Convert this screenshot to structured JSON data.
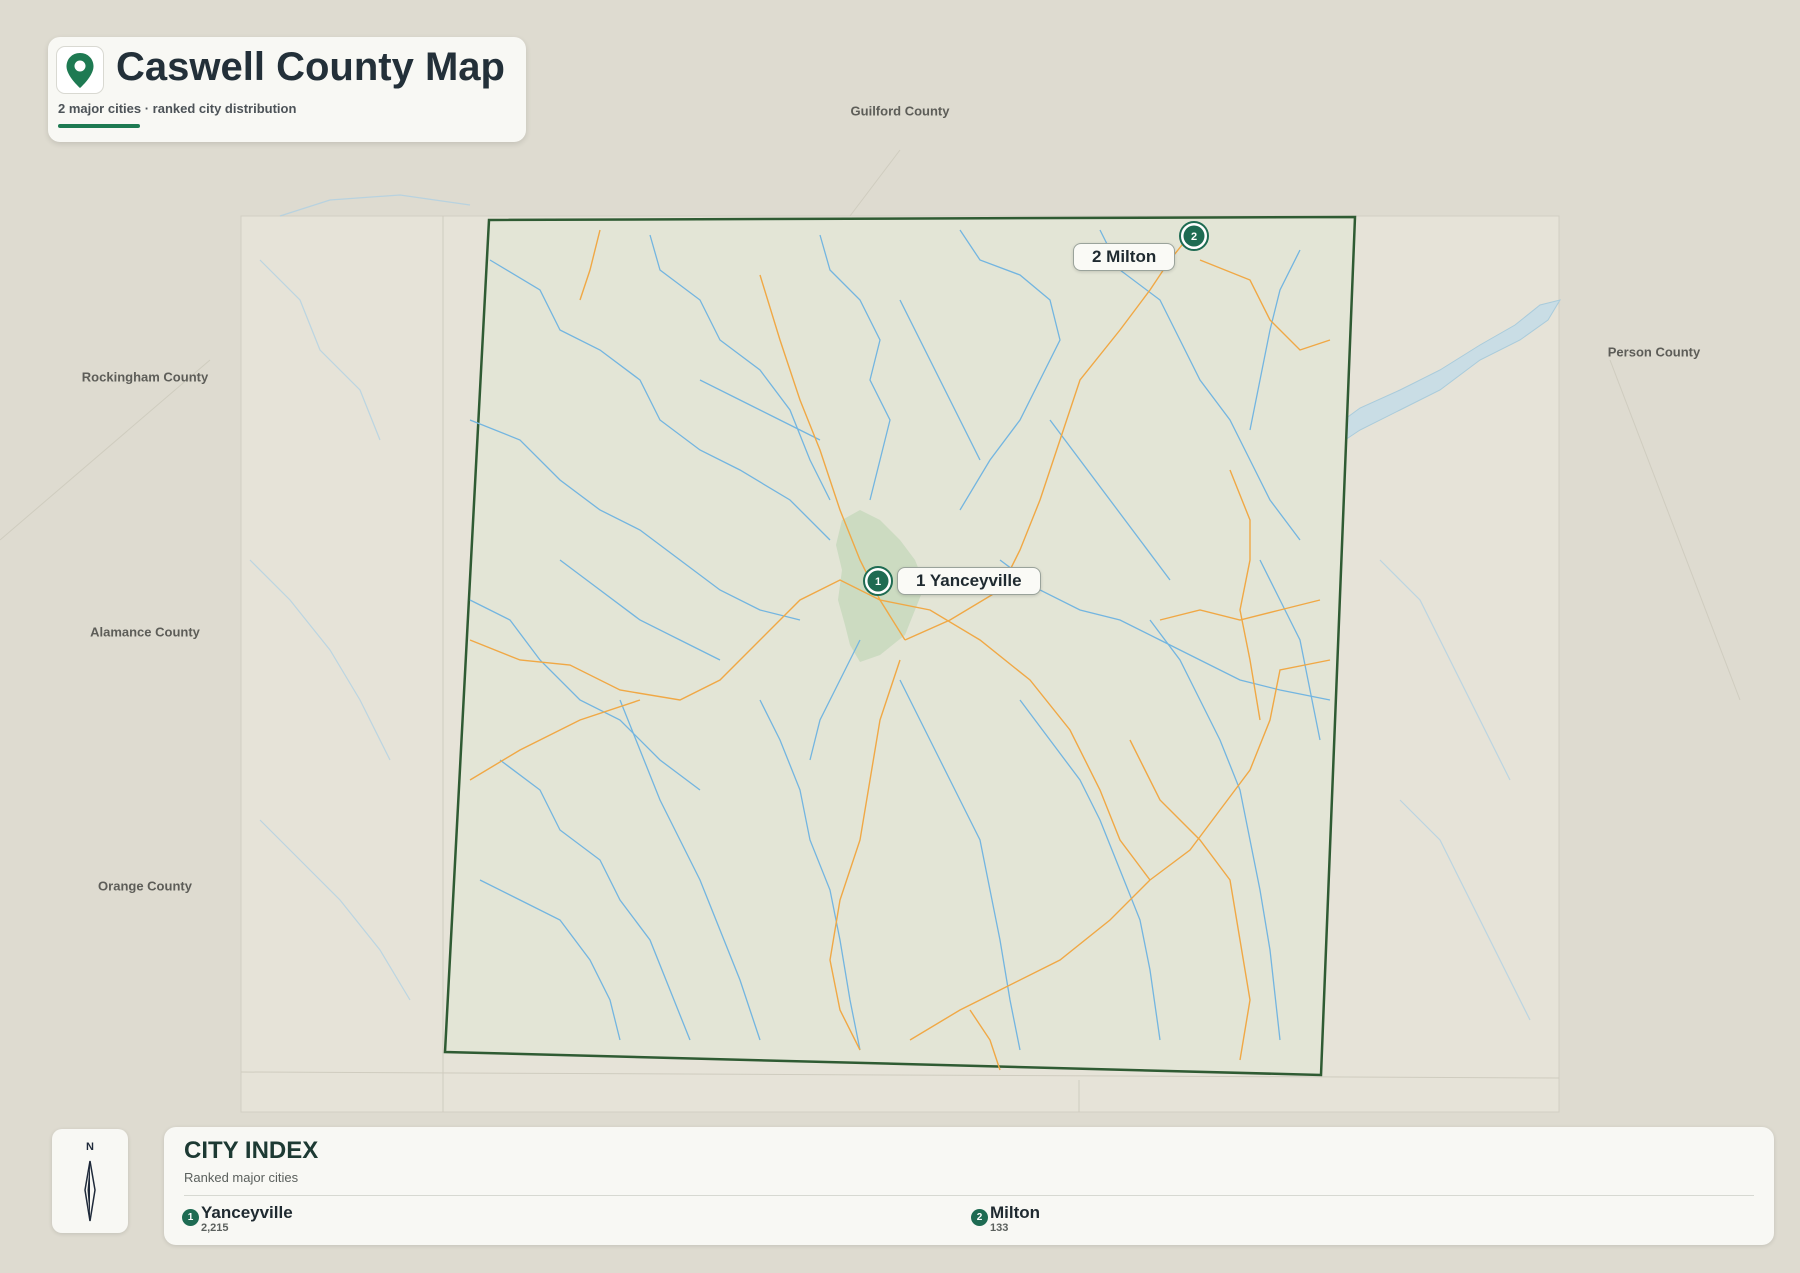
{
  "header": {
    "title": "Caswell County Map",
    "subtitle": "2 major cities · ranked city distribution"
  },
  "map": {
    "neighbors": [
      {
        "name": "Guilford County"
      },
      {
        "name": "Rockingham County"
      },
      {
        "name": "Person County"
      },
      {
        "name": "Alamance County"
      },
      {
        "name": "Orange County"
      }
    ],
    "cities": [
      {
        "rank": "1",
        "name": "Yanceyville",
        "label": "1 Yanceyville"
      },
      {
        "rank": "2",
        "name": "Milton",
        "label": "2 Milton"
      }
    ],
    "compass": {
      "north_label": "N"
    }
  },
  "index": {
    "title": "CITY INDEX",
    "subtitle": "Ranked major cities",
    "entries": [
      {
        "rank": "1",
        "name": "Yanceyville",
        "population": "2,215"
      },
      {
        "rank": "2",
        "name": "Milton",
        "population": "133"
      }
    ]
  },
  "colors": {
    "background": "#dedbd0",
    "county_fill": "#e3e5d6",
    "county_border": "#2f5b33",
    "rivers": "#73b5e0",
    "roads": "#f0a845",
    "marker": "#1e6b52",
    "accent": "#1e7a52"
  }
}
